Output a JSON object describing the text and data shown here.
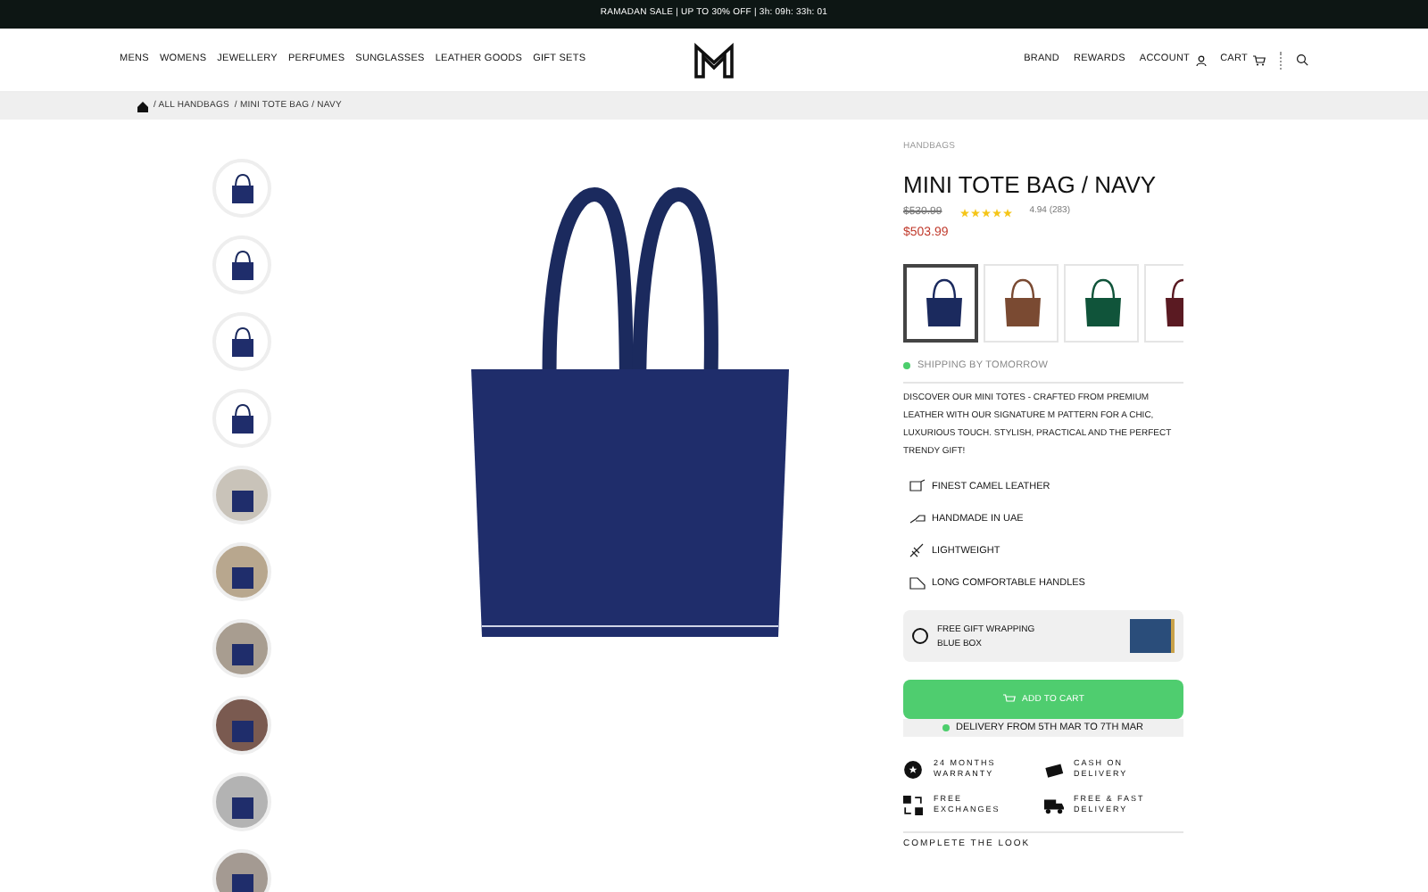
{
  "announcement": "RAMADAN SALE | UP TO 30% OFF | 3h: 09h: 33h: 01",
  "nav_left": [
    "MENS",
    "WOMENS",
    "JEWELLERY",
    "PERFUMES",
    "SUNGLASSES",
    "LEATHER GOODS",
    "GIFT SETS"
  ],
  "nav_right": [
    {
      "label": "BRAND",
      "kind": "plain"
    },
    {
      "label": "REWARDS",
      "kind": "plain"
    },
    {
      "label": "ACCOUNT",
      "kind": "user"
    },
    {
      "label": "CART",
      "kind": "cart"
    }
  ],
  "breadcrumb": [
    "/ ALL HANDBAGS",
    "/ MINI TOTE BAG / NAVY"
  ],
  "thumbnails": [
    {
      "kind": "bag"
    },
    {
      "kind": "bag"
    },
    {
      "kind": "bag"
    },
    {
      "kind": "bag"
    },
    {
      "kind": "photo"
    },
    {
      "kind": "photo"
    },
    {
      "kind": "photo"
    },
    {
      "kind": "photo"
    },
    {
      "kind": "photo"
    },
    {
      "kind": "photo"
    }
  ],
  "product": {
    "category": "HANDBAGS",
    "title": "MINI TOTE BAG / NAVY",
    "old_price": "$530.99",
    "price": "$503.99",
    "stars": 5,
    "rating": "4.94 (283)",
    "swatches": [
      {
        "color": "#1b2a5e",
        "selected": true
      },
      {
        "color": "#7a4a32",
        "selected": false
      },
      {
        "color": "#10543a",
        "selected": false
      },
      {
        "color": "#5a1a22",
        "selected": false
      }
    ],
    "shipping": "SHIPPING BY TOMORROW",
    "description": "DISCOVER OUR MINI TOTES - CRAFTED FROM PREMIUM LEATHER WITH OUR SIGNATURE M PATTERN FOR A CHIC, LUXURIOUS TOUCH. STYLISH, PRACTICAL AND THE PERFECT TRENDY GIFT!",
    "features": [
      {
        "kind": "leather",
        "label": "FINEST CAMEL LEATHER"
      },
      {
        "kind": "hand",
        "label": "HANDMADE IN UAE"
      },
      {
        "kind": "feather",
        "label": "LIGHTWEIGHT"
      },
      {
        "kind": "handle",
        "label": "LONG COMFORTABLE HANDLES"
      }
    ],
    "gift_wrap": {
      "checked": false,
      "lines": [
        "FREE GIFT WRAPPING",
        "BLUE BOX"
      ]
    },
    "add_to_cart": "ADD TO CART",
    "delivery": "DELIVERY FROM 5TH MAR TO 7TH MAR",
    "perks": [
      {
        "kind": "warranty",
        "label": "24 MONTHS WARRANTY"
      },
      {
        "kind": "cash",
        "label": "CASH ON DELIVERY"
      },
      {
        "kind": "exchange",
        "label": "FREE EXCHANGES"
      },
      {
        "kind": "truck",
        "label": "FREE & FAST DELIVERY"
      }
    ],
    "complete_the_look": "COMPLETE THE LOOK"
  }
}
